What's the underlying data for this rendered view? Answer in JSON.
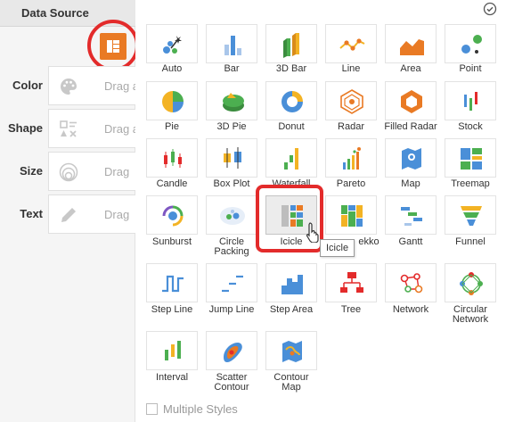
{
  "left_panel": {
    "tab_title": "Data Source",
    "bindings": [
      {
        "label": "Color",
        "placeholder": "Drag a"
      },
      {
        "label": "Shape",
        "placeholder": "Drag a"
      },
      {
        "label": "Size",
        "placeholder": "Drag"
      },
      {
        "label": "Text",
        "placeholder": "Drag"
      }
    ]
  },
  "chart_types": [
    {
      "row": [
        "Auto",
        "Bar",
        "3D Bar",
        "Line",
        "Area",
        "Point"
      ]
    },
    {
      "row": [
        "Pie",
        "3D Pie",
        "Donut",
        "Radar",
        "Filled Radar",
        "Stock"
      ]
    },
    {
      "row": [
        "Candle",
        "Box Plot",
        "Waterfall",
        "Pareto",
        "Map",
        "Treemap"
      ]
    },
    {
      "row": [
        "Sunburst",
        "Circle\nPacking",
        "Icicle",
        "Marekko",
        "Gantt",
        "Funnel"
      ]
    },
    {
      "row": [
        "Step Line",
        "Jump Line",
        "Step Area",
        "Tree",
        "Network",
        "Circular\nNetwork"
      ]
    },
    {
      "row": [
        "Interval",
        "Scatter\nContour",
        "Contour\nMap"
      ]
    }
  ],
  "labels": {
    "auto": "Auto",
    "bar": "Bar",
    "bar3d": "3D Bar",
    "line": "Line",
    "area": "Area",
    "point": "Point",
    "pie": "Pie",
    "pie3d": "3D Pie",
    "donut": "Donut",
    "radar": "Radar",
    "filled_radar": "Filled Radar",
    "stock": "Stock",
    "candle": "Candle",
    "box_plot": "Box Plot",
    "waterfall": "Waterfall",
    "pareto": "Pareto",
    "map": "Map",
    "treemap": "Treemap",
    "sunburst": "Sunburst",
    "circle_packing_1": "Circle",
    "circle_packing_2": "Packing",
    "icicle": "Icicle",
    "marekko_partial": "ekko",
    "gantt": "Gantt",
    "funnel": "Funnel",
    "step_line": "Step Line",
    "jump_line": "Jump Line",
    "step_area": "Step Area",
    "tree": "Tree",
    "network": "Network",
    "circular_network_1": "Circular",
    "circular_network_2": "Network",
    "interval": "Interval",
    "scatter_contour_1": "Scatter",
    "scatter_contour_2": "Contour",
    "contour_map_1": "Contour",
    "contour_map_2": "Map"
  },
  "tooltip": "Icicle",
  "tooltip_visible": "icicle",
  "selected_chart": "Icicle",
  "multiple_styles_label": "Multiple Styles",
  "multiple_styles_checked": false,
  "colors": {
    "accent": "#e97a24",
    "highlight": "#e32b2b",
    "blue": "#4a8fd8",
    "green": "#4caf50",
    "yellow": "#f3b324"
  }
}
